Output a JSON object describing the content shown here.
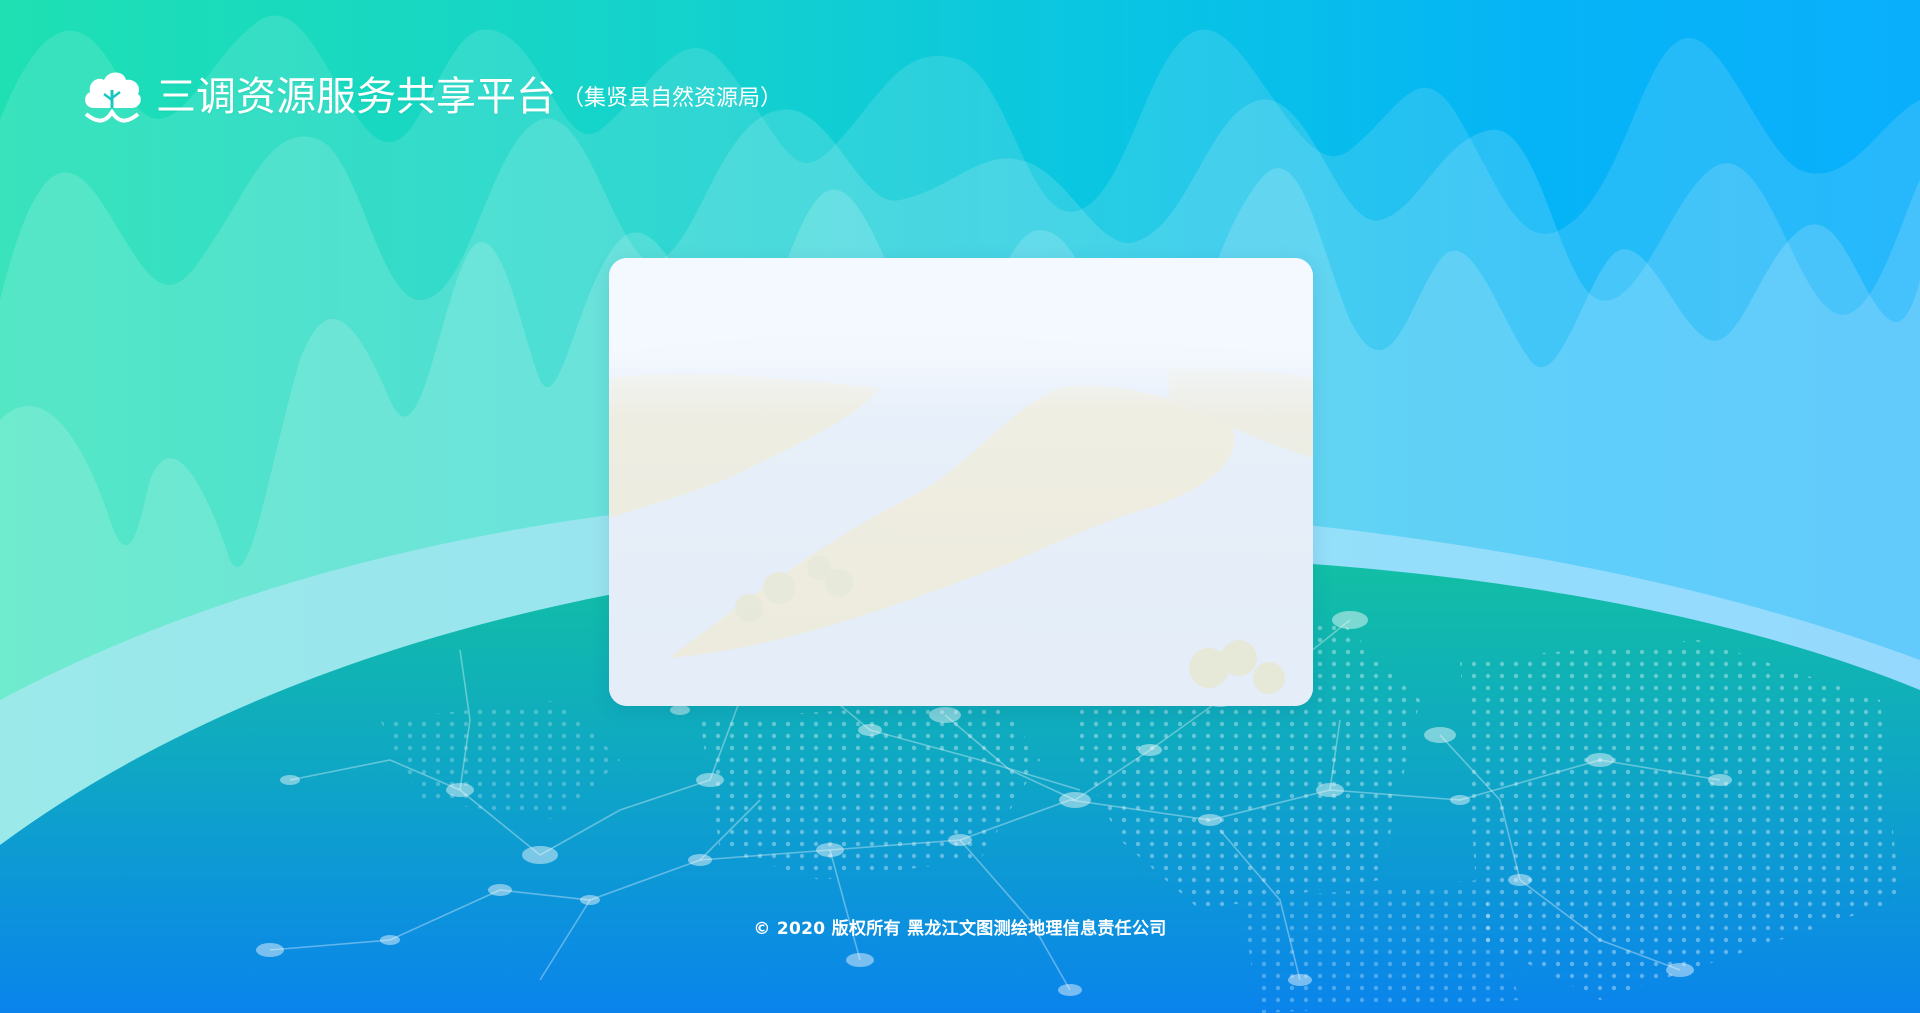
{
  "header": {
    "logo_icon": "cloud-tree-icon",
    "title": "三调资源服务共享平台",
    "subtitle": "（集贤县自然资源局）"
  },
  "login_card": {
    "background_image": "river-landscape-image"
  },
  "footer": {
    "copyright": "© 2020 版权所有 黑龙江文图测绘地理信息责任公司"
  },
  "colors": {
    "gradient_left": "#1ee0b3",
    "gradient_right": "#0aaffc",
    "globe_top": "#12bfa4",
    "globe_bottom": "#0a88ea",
    "text": "#ffffff"
  }
}
